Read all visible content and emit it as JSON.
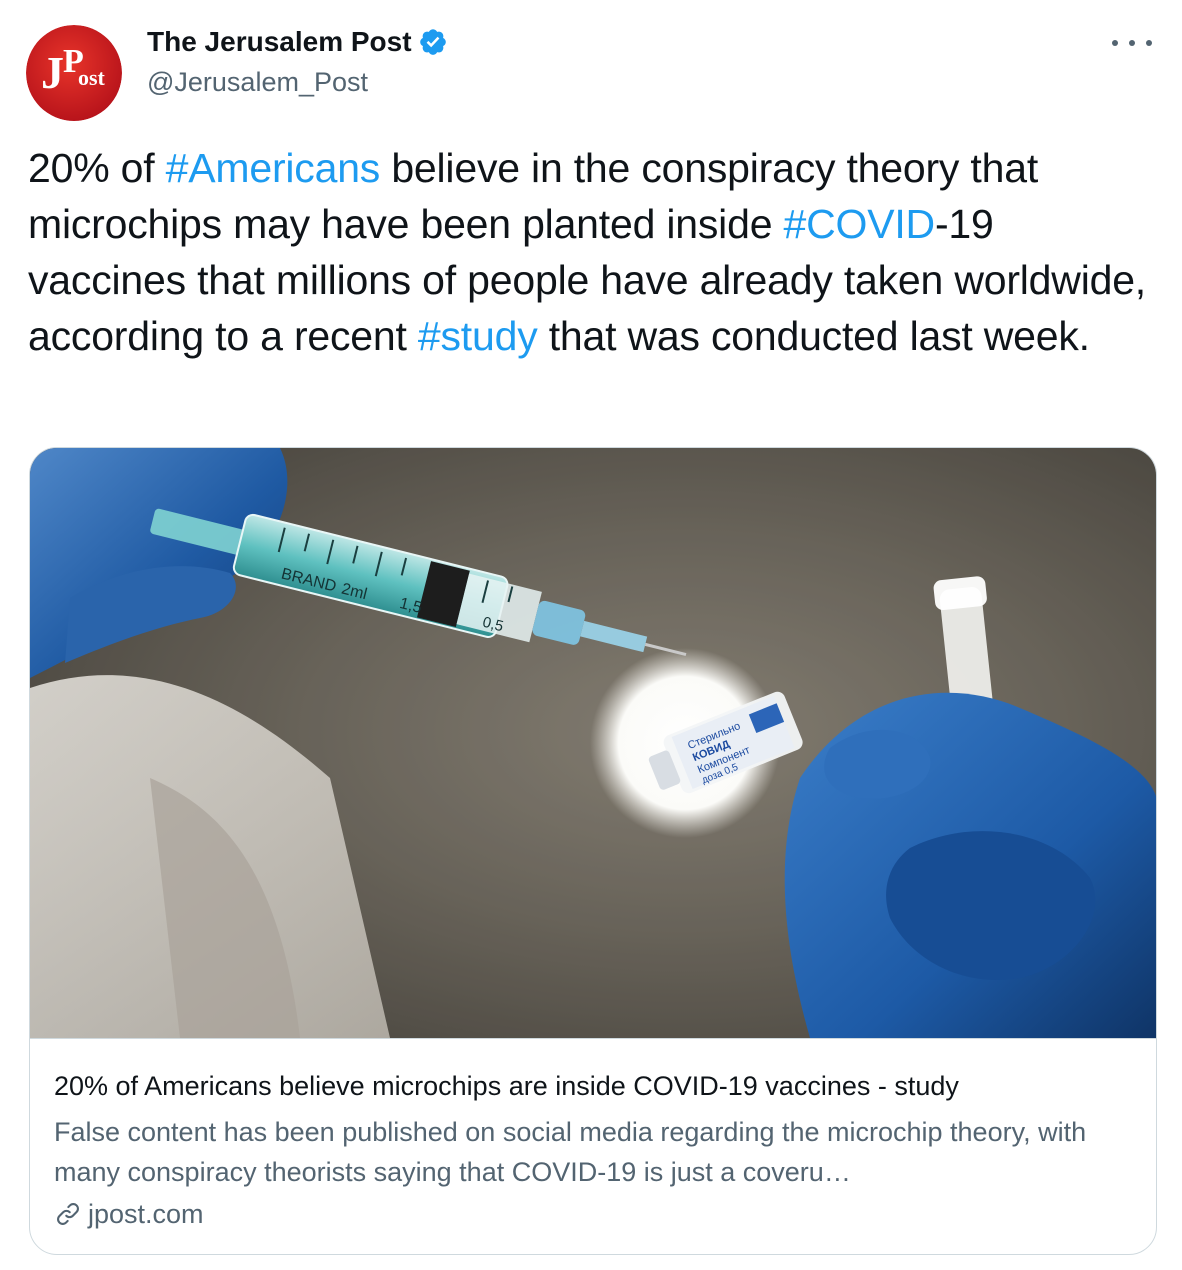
{
  "author": {
    "display_name": "The Jerusalem Post",
    "handle": "@Jerusalem_Post",
    "verified": true,
    "avatar_text": "JPost",
    "avatar_color": "#d71920"
  },
  "tweet": {
    "segments": [
      {
        "text": "20% of ",
        "type": "text"
      },
      {
        "text": "#Americans",
        "type": "hashtag"
      },
      {
        "text": " believe in the conspiracy theory that microchips may have been planted inside ",
        "type": "text"
      },
      {
        "text": "#COVID",
        "type": "hashtag"
      },
      {
        "text": "-19 vaccines that millions of people have already taken worldwide, according to a recent ",
        "type": "text"
      },
      {
        "text": "#study",
        "type": "hashtag"
      },
      {
        "text": " that was conducted last week.",
        "type": "text"
      }
    ]
  },
  "card": {
    "title": "20% of Americans believe microchips are inside COVID-19 vaccines - study",
    "description": "False content has been published on social media regarding the microchip theory, with many conspiracy theorists saying that COVID-19 is just a coveru…",
    "domain": "jpost.com",
    "image_alt": "Gloved hands filling a syringe from a vaccine vial",
    "syringe_label": "BRAND",
    "syringe_marks": [
      "2ml",
      "1,5",
      "0,5"
    ],
    "vial_label": [
      "Стерильно",
      "КОВИД",
      "Компонент",
      "доза 0,5"
    ]
  },
  "colors": {
    "hashtag": "#1d9bf0",
    "secondary_text": "#536471",
    "border": "#cfd9de",
    "verified": "#1d9bf0"
  },
  "icons": {
    "more": "more-horizontal-icon",
    "verified": "verified-badge-icon",
    "link": "link-icon"
  }
}
